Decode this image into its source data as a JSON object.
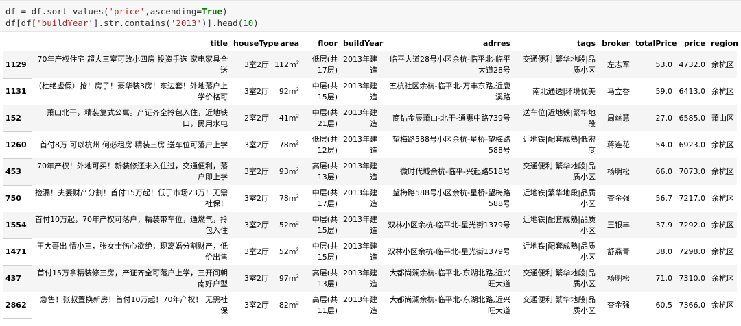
{
  "code": {
    "line1_parts": [
      "df = df.sort_values(",
      "'price'",
      ",ascending=",
      "True",
      ")"
    ],
    "line2_parts": [
      "df[df[",
      "'buildYear'",
      "].str.contains(",
      "'2013'",
      ")].head(",
      "10",
      ")"
    ]
  },
  "table": {
    "columns": [
      "",
      "title",
      "houseType",
      "area",
      "floor",
      "buildYear",
      "adrres",
      "tags",
      "broker",
      "totalPrice",
      "price",
      "region"
    ],
    "rows": [
      {
        "idx": "1129",
        "title": "70年产权住宅 超大三室可改小四房 投资手选 家电家具全送",
        "houseType": "3室2厅",
        "area": "112m",
        "floor": "低层(共17层)",
        "buildYear": "2013年建造",
        "adrres": "临平大道28号小区余杭-临平北-临平大道28号",
        "tags": "交通便利|繁华地段|品质小区",
        "broker": "左志军",
        "totalPrice": "53.0",
        "price": "4732.0",
        "region": "余杭区"
      },
      {
        "idx": "1131",
        "title": "（杜绝虚假）抢！房子！豪华装3房！东边套！外地落户上学价格可",
        "houseType": "3室2厅",
        "area": "92m",
        "floor": "中层(共15层)",
        "buildYear": "2013年建造",
        "adrres": "五杭社区余杭-临平北-万丰东路,近鹿溪路",
        "tags": "南北通透|环境优美",
        "broker": "马立香",
        "totalPrice": "59.0",
        "price": "6413.0",
        "region": "余杭区"
      },
      {
        "idx": "152",
        "title": "萧山北干，精装复式公寓。产证齐全拎包入住，近地铁口，民用水电",
        "houseType": "2室2厅",
        "area": "41m",
        "floor": "中层(共21层)",
        "buildYear": "2013年建造",
        "adrres": "商钻金辰萧山-北干-通惠中路739号",
        "tags": "送车位|近地铁|繁华地段",
        "broker": "周丝慧",
        "totalPrice": "27.0",
        "price": "6585.0",
        "region": "萧山区"
      },
      {
        "idx": "1260",
        "title": "首付8万 可以杭州 何必租房 精装三房 送车位可落户上学",
        "houseType": "3室2厅",
        "area": "78m",
        "floor": "低层(共12层)",
        "buildYear": "2013年建造",
        "adrres": "望梅路588号小区余杭-星桥-望梅路588号",
        "tags": "近地铁|配套成熟|低密度",
        "broker": "蒋连花",
        "totalPrice": "54.0",
        "price": "6923.0",
        "region": "余杭区"
      },
      {
        "idx": "453",
        "title": "70年产权！外地可买！新装修还未入住过，交通便利，落户即上学",
        "houseType": "3室2厅",
        "area": "93m",
        "floor": "高层(共13层)",
        "buildYear": "2013年建造",
        "adrres": "微时代城余杭-临平-兴起路518号",
        "tags": "交通便利|繁华地段|品质小区",
        "broker": "杨明松",
        "totalPrice": "66.0",
        "price": "7073.0",
        "region": "余杭区"
      },
      {
        "idx": "750",
        "title": "捡漏！夫妻财产分割！首付15万起！低于市场23万！无需社保！",
        "houseType": "3室2厅",
        "area": "78m",
        "floor": "中层(共17层)",
        "buildYear": "2013年建造",
        "adrres": "望梅路588号小区余杭-星桥-望梅路588号",
        "tags": "近地铁|繁华地段|品质小区",
        "broker": "查金强",
        "totalPrice": "56.7",
        "price": "7217.0",
        "region": "余杭区"
      },
      {
        "idx": "1554",
        "title": "首付10万起，70年产权可落户，精装带车位，通燃气，拎包入住",
        "houseType": "3室2厅",
        "area": "52m",
        "floor": "中层(共15层)",
        "buildYear": "2013年建造",
        "adrres": "双林小区余杭-临平北-星光街1379号",
        "tags": "近地铁|配套成熟|品质小区",
        "broker": "王银丰",
        "totalPrice": "37.9",
        "price": "7292.0",
        "region": "余杭区"
      },
      {
        "idx": "1471",
        "title": "王大哥出 情小三，张女士伤心欲绝，现离婚分割财产，低价出售",
        "houseType": "3室2厅",
        "area": "52m",
        "floor": "中层(共15层)",
        "buildYear": "2013年建造",
        "adrres": "双林小区余杭-临平北-星光街1379号",
        "tags": "近地铁|配套成熟|品质小区",
        "broker": "舒燕青",
        "totalPrice": "38.0",
        "price": "7298.0",
        "region": "余杭区"
      },
      {
        "idx": "437",
        "title": "首付15万拿精装修三房，产证齐全可落户上学，三开间朝南好户型",
        "houseType": "3室2厅",
        "area": "97m",
        "floor": "高层(共13层)",
        "buildYear": "2013年建造",
        "adrres": "大都尚澜余杭-临平北-东湖北路,近兴旺大道",
        "tags": "交通便利|繁华地段|品质小区",
        "broker": "杨明松",
        "totalPrice": "71.0",
        "price": "7310.0",
        "region": "余杭区"
      },
      {
        "idx": "2862",
        "title": "急售！张叔置换新房！首付10万起！70年产权！ 无需社保",
        "houseType": "3室2厅",
        "area": "82m",
        "floor": "高层(共11层)",
        "buildYear": "2013年建造",
        "adrres": "大都尚澜余杭-临平北-东湖北路,近兴旺大道",
        "tags": "交通便利|繁华地段|品质小区",
        "broker": "查金强",
        "totalPrice": "60.5",
        "price": "7366.0",
        "region": "余杭区"
      }
    ]
  }
}
